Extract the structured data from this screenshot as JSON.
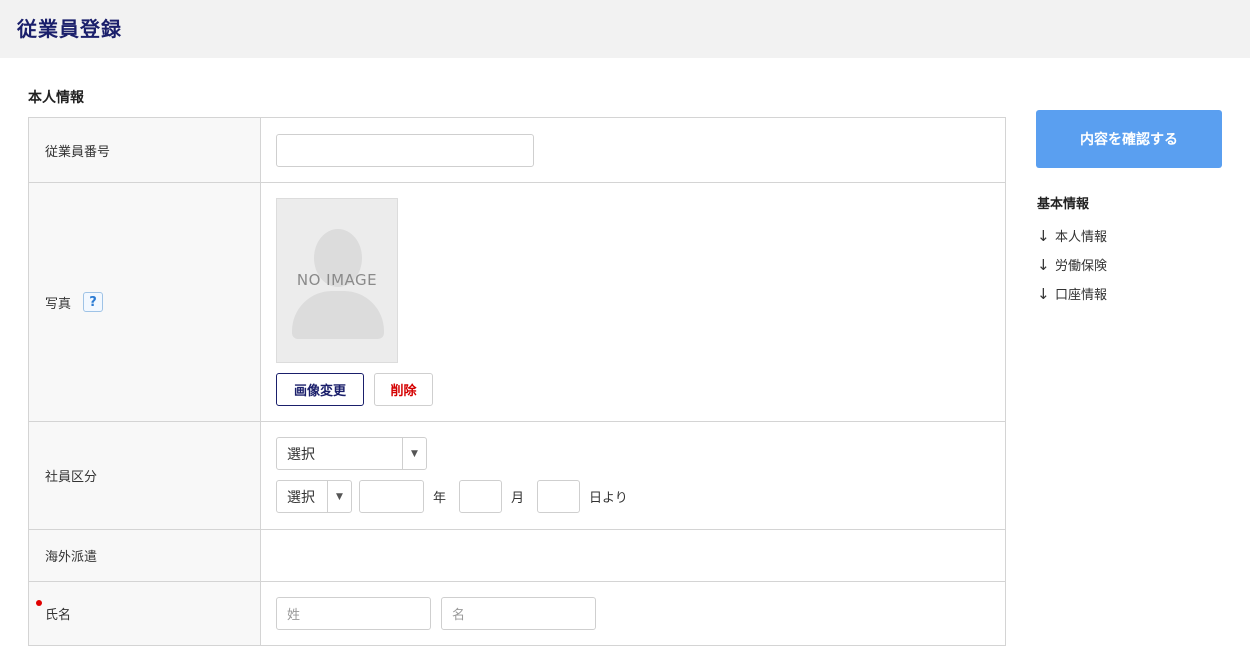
{
  "header": {
    "title": "従業員登録"
  },
  "section": {
    "title": "本人情報"
  },
  "form": {
    "employee_number": {
      "label": "従業員番号",
      "value": ""
    },
    "photo": {
      "label": "写真",
      "help": "?",
      "placeholder_text": "NO IMAGE",
      "change_button": "画像変更",
      "delete_button": "削除"
    },
    "employee_type": {
      "label": "社員区分",
      "type_select": "選択",
      "era_select": "選択",
      "year_unit": "年",
      "month_unit": "月",
      "day_unit": "日より"
    },
    "overseas": {
      "label": "海外派遣"
    },
    "name": {
      "label": "氏名",
      "required": true,
      "last_placeholder": "姓",
      "first_placeholder": "名"
    }
  },
  "sidebar": {
    "confirm_button": "内容を確認する",
    "toc_title": "基本情報",
    "toc_items": [
      "本人情報",
      "労働保険",
      "口座情報"
    ]
  },
  "colors": {
    "title": "#1a1f6b",
    "confirm_button": "#5a9ff0",
    "required": "#e00000",
    "delete_text": "#d40000"
  }
}
